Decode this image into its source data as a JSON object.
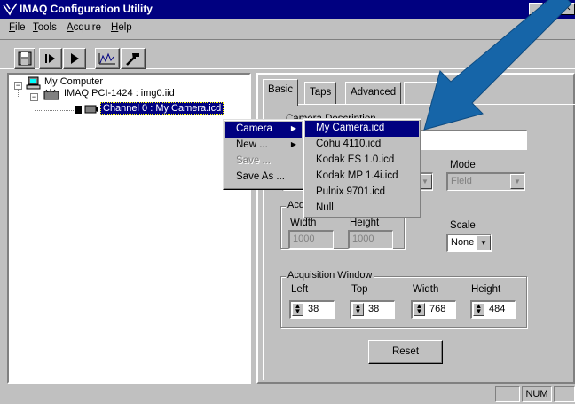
{
  "window": {
    "title": "IMAQ Configuration Utility",
    "minimize_glyph": "_",
    "maximize_glyph": "□",
    "close_glyph": "✕"
  },
  "menubar": [
    {
      "label": "File",
      "mnemonic_index": 0
    },
    {
      "label": "Tools",
      "mnemonic_index": 0
    },
    {
      "label": "Acquire",
      "mnemonic_index": 0
    },
    {
      "label": "Help",
      "mnemonic_index": 0
    }
  ],
  "toolbar": {
    "icons": [
      "save-icon",
      "step-icon",
      "play-icon",
      "histogram-icon",
      "tools-icon"
    ]
  },
  "tree": {
    "root": "My Computer",
    "board": "IMAQ PCI-1424 : img0.iid",
    "channel": "Channel 0 : My Camera.icd",
    "expander_glyph": "−"
  },
  "context_menu": {
    "items": [
      {
        "label": "Camera",
        "submenu": true,
        "highlighted": true,
        "disabled": false
      },
      {
        "label": "New ...",
        "submenu": true,
        "highlighted": false,
        "disabled": false
      },
      {
        "label": "Save ...",
        "submenu": false,
        "highlighted": false,
        "disabled": true
      },
      {
        "label": "Save As ...",
        "submenu": false,
        "highlighted": false,
        "disabled": false
      }
    ]
  },
  "camera_submenu": {
    "items": [
      "My Camera.icd",
      "Cohu 4110.icd",
      "Kodak ES 1.0.icd",
      "Kodak MP 1.4i.icd",
      "Pulnix 9701.icd",
      "Null"
    ],
    "highlighted_index": 0
  },
  "tabs": [
    "Basic",
    "Taps",
    "Advanced"
  ],
  "basic": {
    "camera_description_label": "Camera Description",
    "camera_description_value": "",
    "mode_label": "Mode",
    "mode_value": "Field",
    "acq_area_label": "Acquisition Area",
    "width_label": "Width",
    "height_label": "Height",
    "width_value": "1000",
    "height_value": "1000",
    "scale_label": "Scale",
    "scale_value": "None",
    "acq_window_label": "Acquisition Window",
    "left_label": "Left",
    "top_label": "Top",
    "win_width_label": "Width",
    "win_height_label": "Height",
    "left_value": "38",
    "top_value": "38",
    "win_width_value": "768",
    "win_height_value": "484",
    "reset_label": "Reset"
  },
  "statusbar": {
    "num_indicator": "NUM"
  },
  "colors": {
    "titlebar": "#000080",
    "arrow": "#1665a8",
    "face": "#c0c0c0"
  }
}
